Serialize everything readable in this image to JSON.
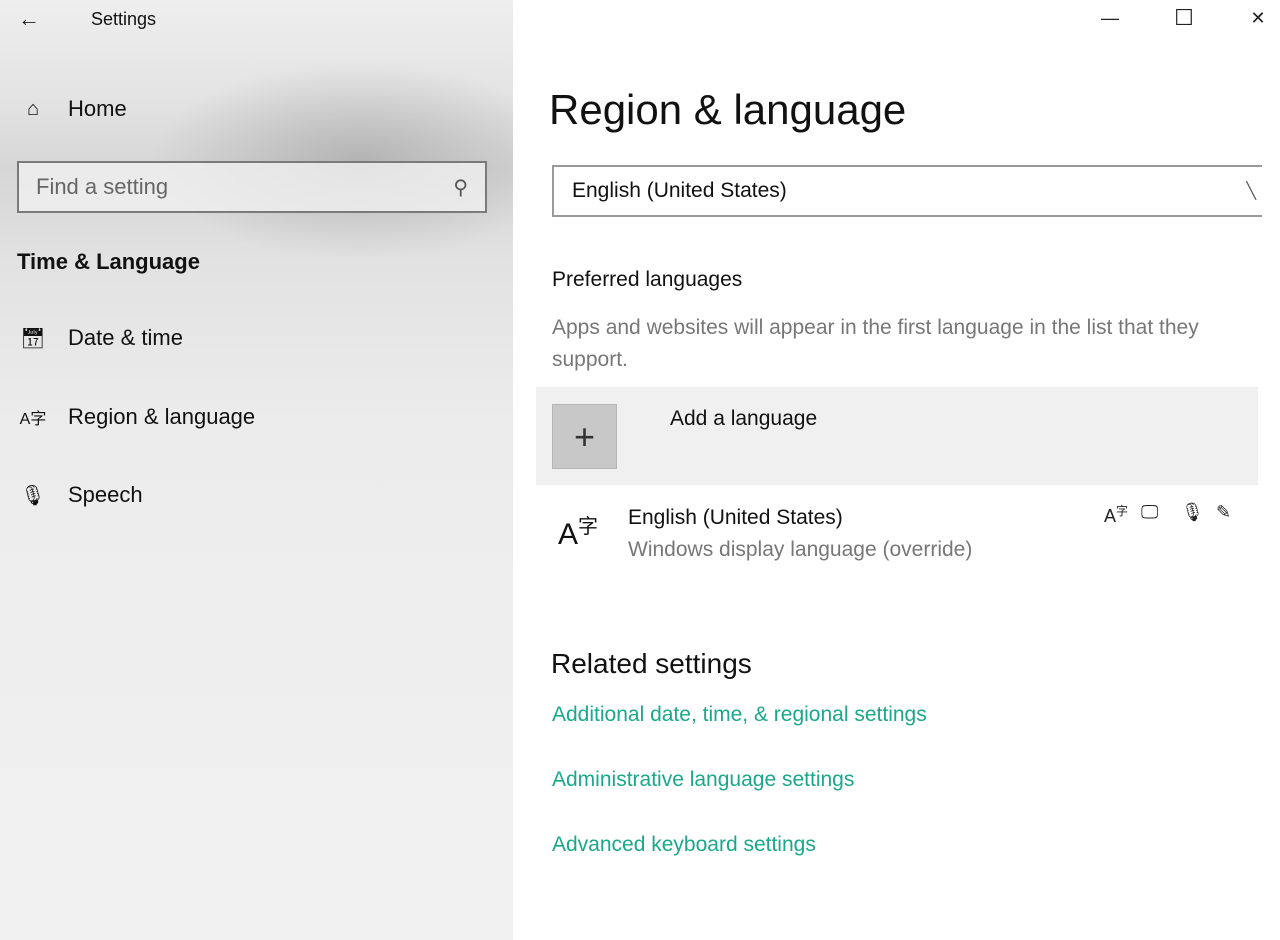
{
  "app": {
    "title": "Settings",
    "back_icon": "back-arrow-icon"
  },
  "window": {
    "minimize": "—",
    "maximize": "☐",
    "close": "✕"
  },
  "sidebar": {
    "home": "Home",
    "search_placeholder": "Find a setting",
    "section": "Time & Language",
    "items": [
      {
        "label": "Date & time",
        "icon": "calendar-clock-icon"
      },
      {
        "label": "Region & language",
        "icon": "language-icon"
      },
      {
        "label": "Speech",
        "icon": "microphone-icon"
      }
    ]
  },
  "main": {
    "title": "Region & language",
    "display_language": "English (United States)",
    "preferred_heading": "Preferred languages",
    "preferred_desc": "Apps and websites will appear in the first language in the list that they support.",
    "add_language": "Add a language",
    "languages": [
      {
        "name": "English (United States)",
        "sub": "Windows display language (override)",
        "features": [
          "language-pack-icon",
          "display-icon",
          "speech-icon",
          "handwriting-icon"
        ]
      }
    ],
    "related_heading": "Related settings",
    "links": [
      "Additional date, time, & regional settings",
      "Administrative language settings",
      "Advanced keyboard settings"
    ],
    "link_color": "#1aa88a"
  }
}
